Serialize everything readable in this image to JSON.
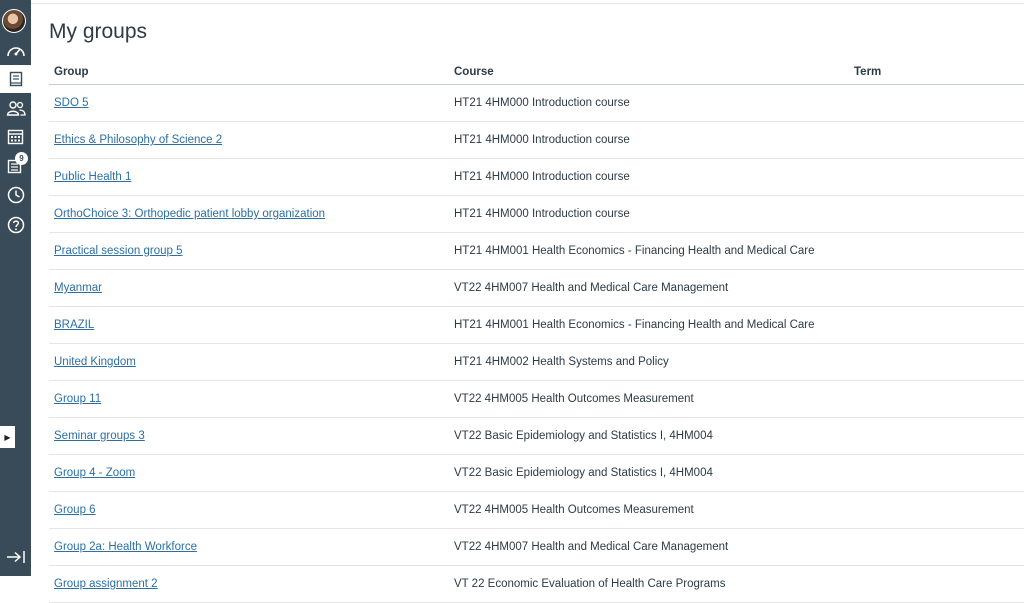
{
  "page": {
    "title": "My groups"
  },
  "nav": {
    "items": [
      {
        "name": "dashboard"
      },
      {
        "name": "courses",
        "active": true
      },
      {
        "name": "groups"
      },
      {
        "name": "calendar"
      },
      {
        "name": "inbox",
        "badge": "9"
      },
      {
        "name": "history"
      },
      {
        "name": "help"
      }
    ],
    "inbox_badge": "9"
  },
  "table": {
    "headers": {
      "group": "Group",
      "course": "Course",
      "term": "Term"
    },
    "rows": [
      {
        "group": "SDO 5",
        "course": "HT21 4HM000 Introduction course",
        "term": ""
      },
      {
        "group": "Ethics & Philosophy of Science 2",
        "course": "HT21 4HM000 Introduction course",
        "term": ""
      },
      {
        "group": "Public Health 1",
        "course": "HT21 4HM000 Introduction course",
        "term": ""
      },
      {
        "group": "OrthoChoice 3: Orthopedic patient lobby organization",
        "course": "HT21 4HM000 Introduction course",
        "term": ""
      },
      {
        "group": "Practical session group 5",
        "course": "HT21 4HM001 Health Economics - Financing Health and Medical Care",
        "term": ""
      },
      {
        "group": "Myanmar",
        "course": "VT22 4HM007 Health and Medical Care Management",
        "term": ""
      },
      {
        "group": "BRAZIL",
        "course": "HT21 4HM001 Health Economics - Financing Health and Medical Care",
        "term": ""
      },
      {
        "group": "United Kingdom",
        "course": "HT21 4HM002 Health Systems and Policy",
        "term": ""
      },
      {
        "group": "Group 11",
        "course": "VT22 4HM005 Health Outcomes Measurement",
        "term": ""
      },
      {
        "group": "Seminar groups 3",
        "course": "VT22 Basic Epidemiology and Statistics I, 4HM004",
        "term": ""
      },
      {
        "group": "Group 4 - Zoom",
        "course": "VT22 Basic Epidemiology and Statistics I, 4HM004",
        "term": ""
      },
      {
        "group": "Group 6",
        "course": "VT22 4HM005 Health Outcomes Measurement",
        "term": ""
      },
      {
        "group": "Group 2a: Health Workforce",
        "course": "VT22 4HM007 Health and Medical Care Management",
        "term": ""
      },
      {
        "group": "Group assignment 2",
        "course": "VT 22 Economic Evaluation of Health Care Programs",
        "term": ""
      }
    ]
  },
  "colors": {
    "nav_bg": "#394b58",
    "link": "#2b6fa3",
    "text": "#2d3b45"
  }
}
